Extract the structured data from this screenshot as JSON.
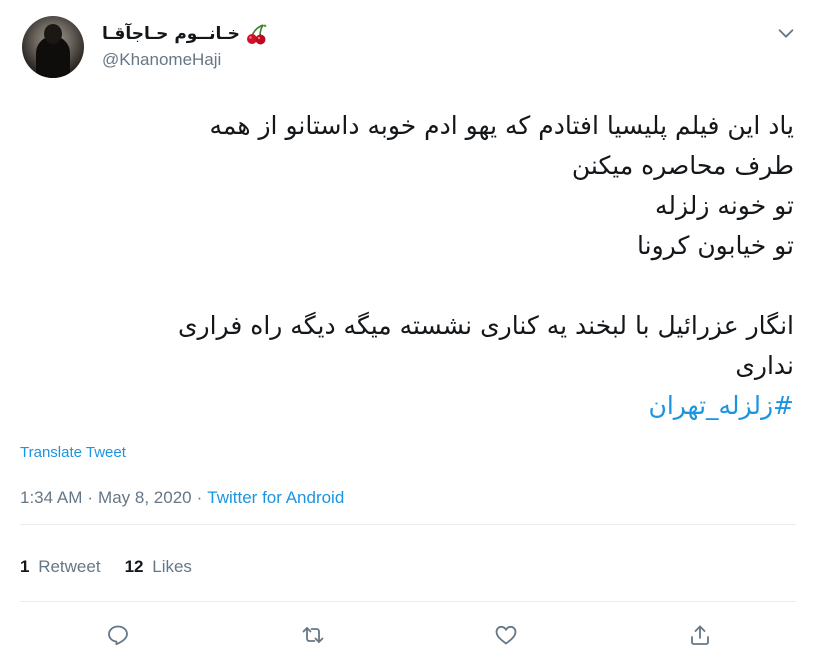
{
  "author": {
    "display_name": "خـانــوم حـاجآقـا",
    "name_emoji": "cherries",
    "handle": "@KhanomeHaji"
  },
  "tweet": {
    "lines": [
      "یاد این فیلم پلیسیا افتادم که یهو ادم خوبه داستانو از همه",
      "طرف محاصره میکنن",
      "تو خونه زلزله",
      "تو خیابون کرونا",
      "",
      "انگار عزرائیل با لبخند یه کناری نشسته میگه دیگه راه فراری",
      "نداری"
    ],
    "hashtag": "#زلزله_تهران"
  },
  "translate_label": "Translate Tweet",
  "meta": {
    "time": "1:34 AM",
    "separator": "·",
    "date": "May 8, 2020",
    "source": "Twitter for Android"
  },
  "stats": {
    "retweets_count": "1",
    "retweets_label": "Retweet",
    "likes_count": "12",
    "likes_label": "Likes"
  },
  "icons": {
    "more": "chevron-down-icon",
    "reply": "reply-icon",
    "retweet": "retweet-icon",
    "like": "heart-icon",
    "share": "share-icon"
  },
  "colors": {
    "link": "#1b95e0",
    "muted": "#657786",
    "text": "#14171a",
    "divider": "#e6ecf0"
  }
}
